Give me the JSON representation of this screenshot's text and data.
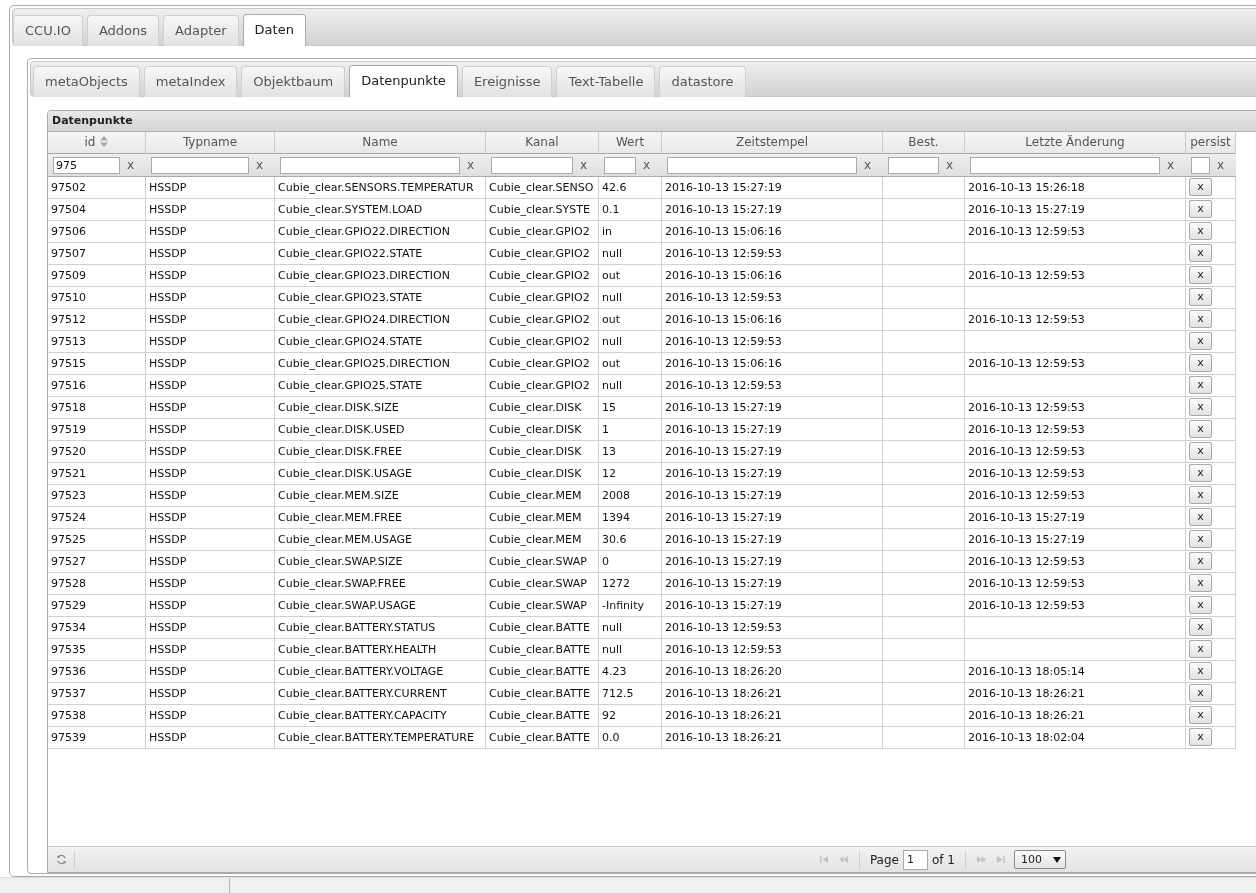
{
  "main_tabs": [
    {
      "label": "CCU.IO",
      "selected": false
    },
    {
      "label": "Addons",
      "selected": false
    },
    {
      "label": "Adapter",
      "selected": false
    },
    {
      "label": "Daten",
      "selected": true
    }
  ],
  "sub_tabs": [
    {
      "label": "metaObjects",
      "selected": false
    },
    {
      "label": "metaIndex",
      "selected": false
    },
    {
      "label": "Objektbaum",
      "selected": false
    },
    {
      "label": "Datenpunkte",
      "selected": true
    },
    {
      "label": "Ereignisse",
      "selected": false
    },
    {
      "label": "Text-Tabelle",
      "selected": false
    },
    {
      "label": "datastore",
      "selected": false
    }
  ],
  "grid": {
    "caption": "Datenpunkte",
    "columns": [
      {
        "label": "id",
        "sorted": true
      },
      {
        "label": "Typname",
        "sorted": false
      },
      {
        "label": "Name",
        "sorted": false
      },
      {
        "label": "Kanal",
        "sorted": false
      },
      {
        "label": "Wert",
        "sorted": false
      },
      {
        "label": "Zeitstempel",
        "sorted": false
      },
      {
        "label": "Best.",
        "sorted": false
      },
      {
        "label": "Letzte Änderung",
        "sorted": false
      },
      {
        "label": "persist",
        "sorted": false
      }
    ],
    "filters": [
      {
        "value": "975",
        "clear": "x"
      },
      {
        "clear": "x"
      },
      {
        "clear": "x"
      },
      {
        "clear": "x"
      },
      {
        "clear": "x"
      },
      {
        "clear": "x"
      },
      {
        "clear": "x"
      },
      {
        "clear": "x"
      },
      {
        "clear": "x"
      }
    ],
    "rows": [
      {
        "id": "97502",
        "typname": "HSSDP",
        "name": "Cubie_clear.SENSORS.TEMPERATUR",
        "kanal": "Cubie_clear.SENSO",
        "wert": "42.6",
        "zeitstempel": "2016-10-13 15:27:19",
        "letzte_aenderung": "2016-10-13 15:26:18",
        "persist": "x"
      },
      {
        "id": "97504",
        "typname": "HSSDP",
        "name": "Cubie_clear.SYSTEM.LOAD",
        "kanal": "Cubie_clear.SYSTE",
        "wert": "0.1",
        "zeitstempel": "2016-10-13 15:27:19",
        "letzte_aenderung": "2016-10-13 15:27:19",
        "persist": "x"
      },
      {
        "id": "97506",
        "typname": "HSSDP",
        "name": "Cubie_clear.GPIO22.DIRECTION",
        "kanal": "Cubie_clear.GPIO2",
        "wert": "in",
        "zeitstempel": "2016-10-13 15:06:16",
        "letzte_aenderung": "2016-10-13 12:59:53",
        "persist": "x"
      },
      {
        "id": "97507",
        "typname": "HSSDP",
        "name": "Cubie_clear.GPIO22.STATE",
        "kanal": "Cubie_clear.GPIO2",
        "wert": "null",
        "zeitstempel": "2016-10-13 12:59:53",
        "persist": "x"
      },
      {
        "id": "97509",
        "typname": "HSSDP",
        "name": "Cubie_clear.GPIO23.DIRECTION",
        "kanal": "Cubie_clear.GPIO2",
        "wert": "out",
        "zeitstempel": "2016-10-13 15:06:16",
        "letzte_aenderung": "2016-10-13 12:59:53",
        "persist": "x"
      },
      {
        "id": "97510",
        "typname": "HSSDP",
        "name": "Cubie_clear.GPIO23.STATE",
        "kanal": "Cubie_clear.GPIO2",
        "wert": "null",
        "zeitstempel": "2016-10-13 12:59:53",
        "persist": "x"
      },
      {
        "id": "97512",
        "typname": "HSSDP",
        "name": "Cubie_clear.GPIO24.DIRECTION",
        "kanal": "Cubie_clear.GPIO2",
        "wert": "out",
        "zeitstempel": "2016-10-13 15:06:16",
        "letzte_aenderung": "2016-10-13 12:59:53",
        "persist": "x"
      },
      {
        "id": "97513",
        "typname": "HSSDP",
        "name": "Cubie_clear.GPIO24.STATE",
        "kanal": "Cubie_clear.GPIO2",
        "wert": "null",
        "zeitstempel": "2016-10-13 12:59:53",
        "persist": "x"
      },
      {
        "id": "97515",
        "typname": "HSSDP",
        "name": "Cubie_clear.GPIO25.DIRECTION",
        "kanal": "Cubie_clear.GPIO2",
        "wert": "out",
        "zeitstempel": "2016-10-13 15:06:16",
        "letzte_aenderung": "2016-10-13 12:59:53",
        "persist": "x"
      },
      {
        "id": "97516",
        "typname": "HSSDP",
        "name": "Cubie_clear.GPIO25.STATE",
        "kanal": "Cubie_clear.GPIO2",
        "wert": "null",
        "zeitstempel": "2016-10-13 12:59:53",
        "persist": "x"
      },
      {
        "id": "97518",
        "typname": "HSSDP",
        "name": "Cubie_clear.DISK.SIZE",
        "kanal": "Cubie_clear.DISK",
        "wert": "15",
        "zeitstempel": "2016-10-13 15:27:19",
        "letzte_aenderung": "2016-10-13 12:59:53",
        "persist": "x"
      },
      {
        "id": "97519",
        "typname": "HSSDP",
        "name": "Cubie_clear.DISK.USED",
        "kanal": "Cubie_clear.DISK",
        "wert": "1",
        "zeitstempel": "2016-10-13 15:27:19",
        "letzte_aenderung": "2016-10-13 12:59:53",
        "persist": "x"
      },
      {
        "id": "97520",
        "typname": "HSSDP",
        "name": "Cubie_clear.DISK.FREE",
        "kanal": "Cubie_clear.DISK",
        "wert": "13",
        "zeitstempel": "2016-10-13 15:27:19",
        "letzte_aenderung": "2016-10-13 12:59:53",
        "persist": "x"
      },
      {
        "id": "97521",
        "typname": "HSSDP",
        "name": "Cubie_clear.DISK.USAGE",
        "kanal": "Cubie_clear.DISK",
        "wert": "12",
        "zeitstempel": "2016-10-13 15:27:19",
        "letzte_aenderung": "2016-10-13 12:59:53",
        "persist": "x"
      },
      {
        "id": "97523",
        "typname": "HSSDP",
        "name": "Cubie_clear.MEM.SIZE",
        "kanal": "Cubie_clear.MEM",
        "wert": "2008",
        "zeitstempel": "2016-10-13 15:27:19",
        "letzte_aenderung": "2016-10-13 12:59:53",
        "persist": "x"
      },
      {
        "id": "97524",
        "typname": "HSSDP",
        "name": "Cubie_clear.MEM.FREE",
        "kanal": "Cubie_clear.MEM",
        "wert": "1394",
        "zeitstempel": "2016-10-13 15:27:19",
        "letzte_aenderung": "2016-10-13 15:27:19",
        "persist": "x"
      },
      {
        "id": "97525",
        "typname": "HSSDP",
        "name": "Cubie_clear.MEM.USAGE",
        "kanal": "Cubie_clear.MEM",
        "wert": "30.6",
        "zeitstempel": "2016-10-13 15:27:19",
        "letzte_aenderung": "2016-10-13 15:27:19",
        "persist": "x"
      },
      {
        "id": "97527",
        "typname": "HSSDP",
        "name": "Cubie_clear.SWAP.SIZE",
        "kanal": "Cubie_clear.SWAP",
        "wert": "0",
        "zeitstempel": "2016-10-13 15:27:19",
        "letzte_aenderung": "2016-10-13 12:59:53",
        "persist": "x"
      },
      {
        "id": "97528",
        "typname": "HSSDP",
        "name": "Cubie_clear.SWAP.FREE",
        "kanal": "Cubie_clear.SWAP",
        "wert": "1272",
        "zeitstempel": "2016-10-13 15:27:19",
        "letzte_aenderung": "2016-10-13 12:59:53",
        "persist": "x"
      },
      {
        "id": "97529",
        "typname": "HSSDP",
        "name": "Cubie_clear.SWAP.USAGE",
        "kanal": "Cubie_clear.SWAP",
        "wert": "-Infinity",
        "zeitstempel": "2016-10-13 15:27:19",
        "letzte_aenderung": "2016-10-13 12:59:53",
        "persist": "x"
      },
      {
        "id": "97534",
        "typname": "HSSDP",
        "name": "Cubie_clear.BATTERY.STATUS",
        "kanal": "Cubie_clear.BATTE",
        "wert": "null",
        "zeitstempel": "2016-10-13 12:59:53",
        "persist": "x"
      },
      {
        "id": "97535",
        "typname": "HSSDP",
        "name": "Cubie_clear.BATTERY.HEALTH",
        "kanal": "Cubie_clear.BATTE",
        "wert": "null",
        "zeitstempel": "2016-10-13 12:59:53",
        "persist": "x"
      },
      {
        "id": "97536",
        "typname": "HSSDP",
        "name": "Cubie_clear.BATTERY.VOLTAGE",
        "kanal": "Cubie_clear.BATTE",
        "wert": "4.23",
        "zeitstempel": "2016-10-13 18:26:20",
        "letzte_aenderung": "2016-10-13 18:05:14",
        "persist": "x"
      },
      {
        "id": "97537",
        "typname": "HSSDP",
        "name": "Cubie_clear.BATTERY.CURRENT",
        "kanal": "Cubie_clear.BATTE",
        "wert": "712.5",
        "zeitstempel": "2016-10-13 18:26:21",
        "letzte_aenderung": "2016-10-13 18:26:21",
        "persist": "x"
      },
      {
        "id": "97538",
        "typname": "HSSDP",
        "name": "Cubie_clear.BATTERY.CAPACITY",
        "kanal": "Cubie_clear.BATTE",
        "wert": "92",
        "zeitstempel": "2016-10-13 18:26:21",
        "letzte_aenderung": "2016-10-13 18:26:21",
        "persist": "x"
      },
      {
        "id": "97539",
        "typname": "HSSDP",
        "name": "Cubie_clear.BATTERY.TEMPERATURE",
        "kanal": "Cubie_clear.BATTE",
        "wert": "0.0",
        "zeitstempel": "2016-10-13 18:26:21",
        "letzte_aenderung": "2016-10-13 18:02:04",
        "persist": "x"
      }
    ],
    "pager": {
      "nav": [
        {
          "kind": "first",
          "disabled": true
        },
        {
          "kind": "prev",
          "disabled": true
        },
        {
          "kind": "next",
          "disabled": true
        },
        {
          "kind": "last",
          "disabled": true
        }
      ],
      "page_label": "Page",
      "page": "1",
      "of_label": "of 1",
      "page_size": "100"
    }
  }
}
